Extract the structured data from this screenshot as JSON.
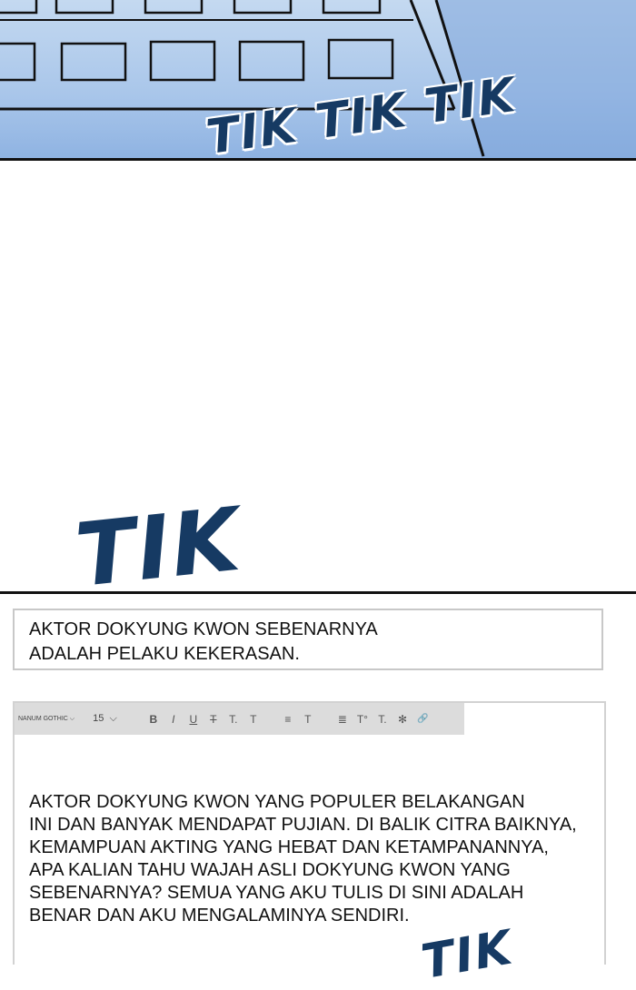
{
  "sfx": {
    "top": "TIK TIK TIK",
    "middle": "TIK",
    "bottom": "TIK"
  },
  "post": {
    "title_lines": [
      "AKTOR DOKYUNG KWON SEBENARNYA",
      "ADALAH PELAKU KEKERASAN."
    ],
    "body_lines": [
      "AKTOR DOKYUNG KWON YANG POPULER BELAKANGAN",
      "INI DAN BANYAK MENDAPAT PUJIAN. DI BALIK CITRA BAIKNYA,",
      "KEMAMPUAN AKTING YANG HEBAT DAN KETAMPANANNYA,",
      "APA KALIAN TAHU WAJAH ASLI DOKYUNG KWON YANG",
      "SEBENARNYA? SEMUA YANG AKU TULIS DI SINI ADALAH",
      "BENAR DAN AKU MENGALAMINYA SENDIRI."
    ]
  },
  "toolbar": {
    "font": "NANUM GOTHIC",
    "size": "15",
    "buttons": {
      "bold": "B",
      "italic": "I",
      "underline": "U",
      "strikethrough": "T",
      "text_color": "T.",
      "text_bg": "T",
      "align": "≡",
      "align_text": "T",
      "line_spacing": "≣",
      "superscript": "T°",
      "subscript": "T.",
      "special_char": "✻",
      "link": "🔗"
    }
  },
  "colors": {
    "sky": "#a9c6ea",
    "sfx": "#163a63",
    "toolbar_bg": "#dcdcdc"
  }
}
